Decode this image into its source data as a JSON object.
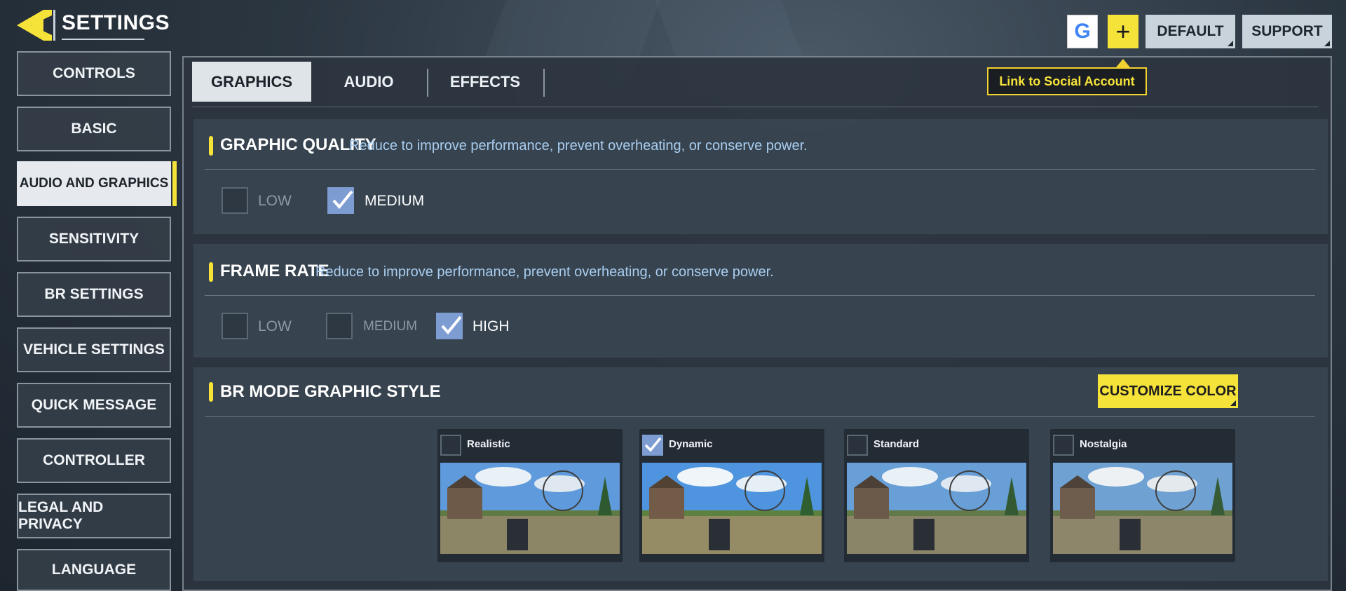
{
  "header": {
    "title": "SETTINGS",
    "buttons": {
      "default": "DEFAULT",
      "support": "SUPPORT",
      "google": "G",
      "plus": "+"
    },
    "tooltip": "Link to Social Account"
  },
  "sidebar": {
    "items": [
      {
        "label": "CONTROLS",
        "active": false
      },
      {
        "label": "BASIC",
        "active": false
      },
      {
        "label": "AUDIO AND GRAPHICS",
        "active": true
      },
      {
        "label": "SENSITIVITY",
        "active": false
      },
      {
        "label": "BR SETTINGS",
        "active": false
      },
      {
        "label": "VEHICLE SETTINGS",
        "active": false
      },
      {
        "label": "QUICK MESSAGE",
        "active": false
      },
      {
        "label": "CONTROLLER",
        "active": false
      },
      {
        "label": "LEGAL AND PRIVACY",
        "active": false
      },
      {
        "label": "LANGUAGE",
        "active": false
      }
    ]
  },
  "tabs": [
    {
      "label": "GRAPHICS",
      "active": true
    },
    {
      "label": "AUDIO",
      "active": false
    },
    {
      "label": "EFFECTS",
      "active": false
    }
  ],
  "graphic_quality": {
    "title": "GRAPHIC QUALITY",
    "description": "Reduce to improve performance, prevent overheating, or conserve power.",
    "options": [
      {
        "label": "LOW",
        "checked": false
      },
      {
        "label": "MEDIUM",
        "checked": true
      }
    ]
  },
  "frame_rate": {
    "title": "FRAME RATE",
    "description": "Reduce to improve performance, prevent overheating, or conserve power.",
    "options": [
      {
        "label": "LOW",
        "checked": false
      },
      {
        "label": "MEDIUM",
        "checked": false
      },
      {
        "label": "HIGH",
        "checked": true
      }
    ]
  },
  "br_style": {
    "title": "BR MODE GRAPHIC STYLE",
    "customize_label": "CUSTOMIZE COLOR",
    "styles": [
      {
        "label": "Realistic",
        "checked": false
      },
      {
        "label": "Dynamic",
        "checked": true
      },
      {
        "label": "Standard",
        "checked": false
      },
      {
        "label": "Nostalgia",
        "checked": false
      }
    ]
  },
  "colors": {
    "accent_yellow": "#f6e33a",
    "check_blue": "#7d9cd2",
    "description_blue": "#a9cdf0"
  }
}
